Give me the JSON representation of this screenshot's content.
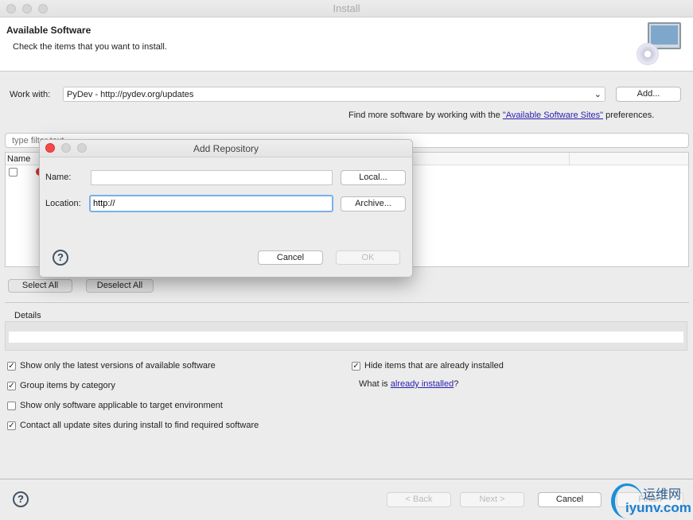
{
  "window": {
    "title": "Install"
  },
  "header": {
    "title": "Available Software",
    "subtitle": "Check the items that you want to install."
  },
  "work_with": {
    "label": "Work with:",
    "value": "PyDev - http://pydev.org/updates",
    "add_label": "Add..."
  },
  "find_more": {
    "prefix": "Find more software by working with the ",
    "link": "\"Available Software Sites\"",
    "suffix": " preferences."
  },
  "filter": {
    "placeholder": "type filter text"
  },
  "table": {
    "columns": [
      "Name"
    ]
  },
  "buttons": {
    "select_all": "Select All",
    "deselect_all": "Deselect All"
  },
  "details": {
    "label": "Details"
  },
  "options": [
    {
      "label": "Show only the latest versions of available software",
      "checked": true
    },
    {
      "label": "Group items by category",
      "checked": true
    },
    {
      "label": "Show only software applicable to target environment",
      "checked": false
    },
    {
      "label": "Contact all update sites during install to find required software",
      "checked": true
    }
  ],
  "hide_installed": {
    "label": "Hide items that are already installed",
    "checked": true
  },
  "what_is": {
    "prefix": "What is ",
    "link": "already installed",
    "suffix": "?"
  },
  "footer": {
    "back": "< Back",
    "next": "Next >",
    "cancel": "Cancel",
    "finish": "Finish"
  },
  "watermark": {
    "text1": "运维网",
    "text2": "iyunv.com"
  },
  "dialog": {
    "title": "Add Repository",
    "name_label": "Name:",
    "name_value": "",
    "location_label": "Location:",
    "location_value": "http://",
    "local": "Local...",
    "archive": "Archive...",
    "cancel": "Cancel",
    "ok": "OK"
  }
}
